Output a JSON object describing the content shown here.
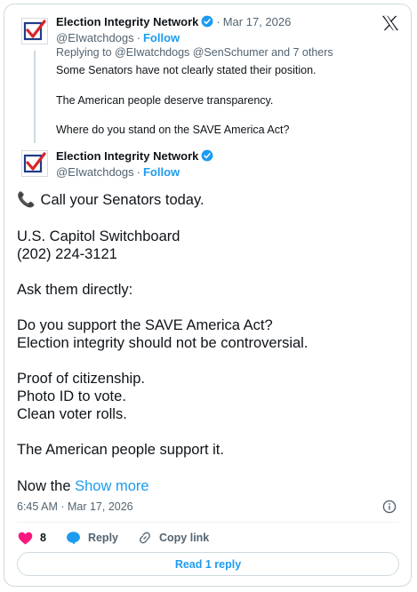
{
  "parent_tweet": {
    "author_name": "Election Integrity Network",
    "separator": "·",
    "date": "Mar 17, 2026",
    "handle": "@EIwatchdogs",
    "follow_label": "Follow",
    "replying_to": "Replying to @EIwatchdogs @SenSchumer and 7 others",
    "lines": [
      "Some Senators have not clearly stated their position.",
      "The American people deserve transparency.",
      "Where do you stand on the SAVE America Act?"
    ]
  },
  "main_tweet": {
    "author_name": "Election Integrity Network",
    "handle": "@EIwatchdogs",
    "follow_label": "Follow",
    "phone_icon": "phone-icon",
    "lines": [
      "Call your Senators today.",
      "U.S. Capitol Switchboard",
      "(202) 224-3121",
      "Ask them directly:",
      "Do you support the SAVE America Act?",
      "Election integrity should not be controversial.",
      "Proof of citizenship.",
      "Photo ID to vote.",
      "Clean voter rolls.",
      "The American people support it.",
      "Now the"
    ],
    "show_more_label": "Show more",
    "timestamp": "6:45 AM · Mar 17, 2026"
  },
  "actions": {
    "like_count": "8",
    "reply_label": "Reply",
    "copy_link_label": "Copy link"
  },
  "read_replies_label": "Read 1 reply",
  "colors": {
    "accent": "#1d9bf0",
    "like": "#f91880",
    "text": "#0f1419",
    "muted": "#536471",
    "border": "#cfd9de"
  }
}
